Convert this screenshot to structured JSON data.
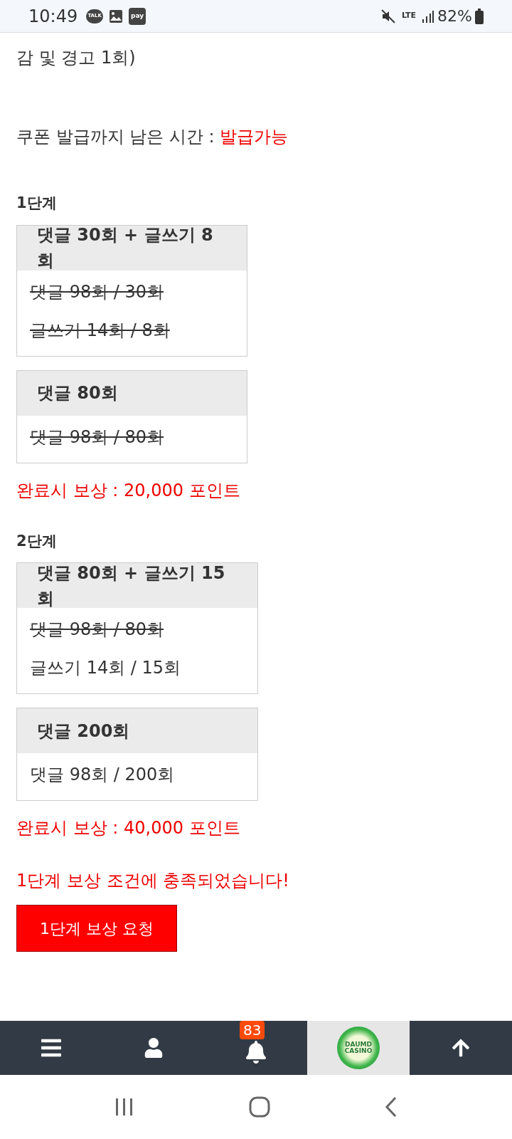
{
  "status_bar": {
    "time": "10:49",
    "notifications": [
      "TALK",
      "pay"
    ],
    "network": "LTE",
    "battery": "82%"
  },
  "intro_tail": "감 및 경고 1회)",
  "coupon": {
    "label": "쿠폰 발급까지 남은 시간 : ",
    "value": "발급가능"
  },
  "stages": [
    {
      "title": "1단계",
      "tasks": [
        {
          "header": "댓글 30회 + 글쓰기 8회",
          "lines": [
            {
              "text": "댓글 98회 / 30회",
              "done": true
            },
            {
              "text": "글쓰기 14회 / 8회",
              "done": true
            }
          ]
        },
        {
          "header": "댓글 80회",
          "lines": [
            {
              "text": "댓글 98회 / 80회",
              "done": true
            }
          ]
        }
      ],
      "reward": "완료시 보상 : 20,000 포인트"
    },
    {
      "title": "2단계",
      "tasks": [
        {
          "header": "댓글 80회 + 글쓰기 15회",
          "lines": [
            {
              "text": "댓글 98회 / 80회",
              "done": true
            },
            {
              "text": "글쓰기 14회 / 15회",
              "done": false
            }
          ]
        },
        {
          "header": "댓글 200회",
          "lines": [
            {
              "text": "댓글 98회 / 200회",
              "done": false
            }
          ]
        }
      ],
      "reward": "완료시 보상 : 40,000 포인트"
    }
  ],
  "message": "1단계 보상 조건에 충족되었습니다!",
  "request_button": "1단계 보상 요청",
  "bottom_nav": [
    {
      "kind": "menu",
      "selected": false
    },
    {
      "kind": "user",
      "selected": false
    },
    {
      "kind": "bell",
      "badge": "83",
      "selected": false
    },
    {
      "kind": "logo",
      "logo_text": [
        "DAUMD",
        "CASINO"
      ],
      "selected": true
    },
    {
      "kind": "top",
      "selected": false
    }
  ]
}
